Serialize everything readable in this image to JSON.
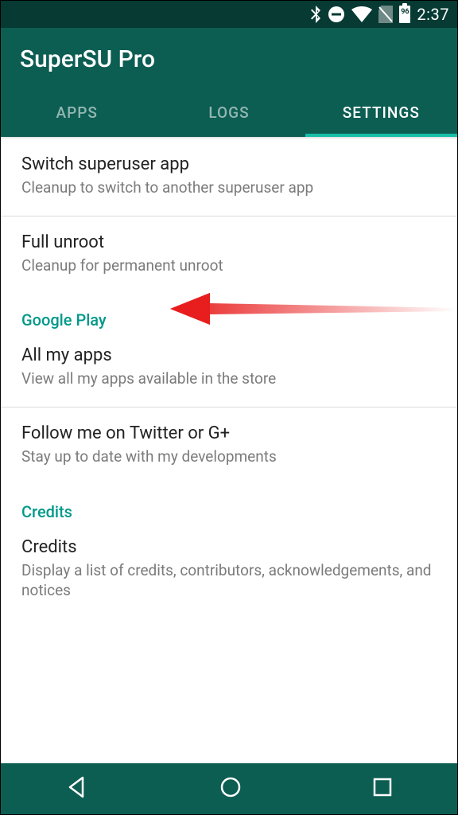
{
  "status": {
    "time": "2:37",
    "battery_level": "96"
  },
  "app": {
    "title": "SuperSU Pro"
  },
  "tabs": {
    "apps": "APPS",
    "logs": "LOGS",
    "settings": "SETTINGS",
    "active": "settings"
  },
  "settings": {
    "switch_superuser": {
      "title": "Switch superuser app",
      "sub": "Cleanup to switch to another superuser app"
    },
    "full_unroot": {
      "title": "Full unroot",
      "sub": "Cleanup for permanent unroot"
    },
    "section_google_play": "Google Play",
    "all_my_apps": {
      "title": "All my apps",
      "sub": "View all my apps available in the store"
    },
    "follow_me": {
      "title": "Follow me on Twitter or G+",
      "sub": "Stay up to date with my developments"
    },
    "section_credits": "Credits",
    "credits": {
      "title": "Credits",
      "sub": "Display a list of credits, contributors, acknowledgements, and notices"
    }
  },
  "colors": {
    "primary": "#0c5d52",
    "primary_dark": "#063a33",
    "accent": "#17bfa8",
    "section_header": "#00998a"
  }
}
